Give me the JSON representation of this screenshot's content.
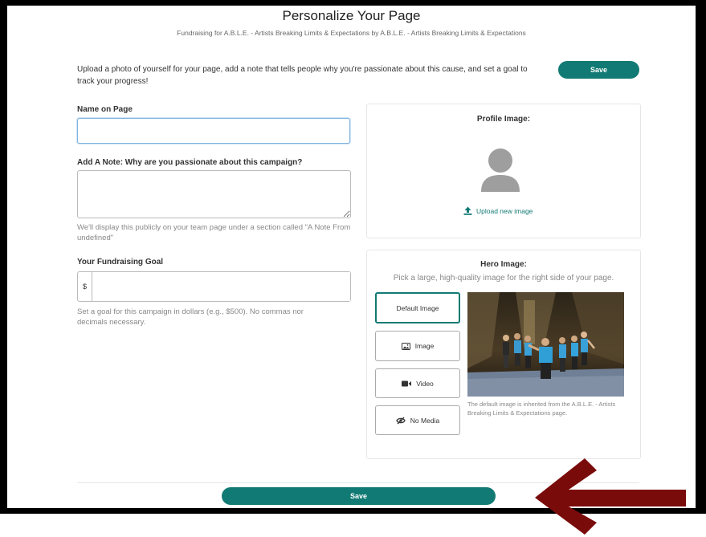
{
  "header": {
    "title": "Personalize Your Page",
    "subtitle": "Fundraising for A.B.L.E. - Artists Breaking Limits & Expectations by A.B.L.E. - Artists Breaking Limits & Expectations"
  },
  "intro": {
    "text": "Upload a photo of yourself for your page, add a note that tells people why you're passionate about this cause, and set a goal to track your progress!",
    "save_label": "Save"
  },
  "form": {
    "name_label": "Name on Page",
    "name_value": "",
    "note_label": "Add A Note: Why are you passionate about this campaign?",
    "note_value": "",
    "note_help": "We'll display this publicly on your team page under a section called \"A Note From undefined\"",
    "goal_label": "Your Fundraising Goal",
    "goal_prefix": "$",
    "goal_value": "",
    "goal_help": "Set a goal for this campaign in dollars (e.g., $500). No commas nor decimals necessary."
  },
  "profile": {
    "title": "Profile Image:",
    "upload_label": "Upload new image"
  },
  "hero": {
    "title": "Hero Image:",
    "subtitle": "Pick a large, high-quality image for the right side of your page.",
    "options": [
      {
        "label": "Default Image",
        "icon": "none",
        "selected": true
      },
      {
        "label": "Image",
        "icon": "image-icon",
        "selected": false
      },
      {
        "label": "Video",
        "icon": "video-camera-icon",
        "selected": false
      },
      {
        "label": "No Media",
        "icon": "eye-slash-icon",
        "selected": false
      }
    ],
    "caption": "The default image is inherited from the A.B.L.E. - Artists Breaking Limits & Expectations page."
  },
  "footer": {
    "save_label": "Save"
  },
  "colors": {
    "accent": "#127a74",
    "arrow": "#7a0b0b",
    "frame": "#000000"
  }
}
